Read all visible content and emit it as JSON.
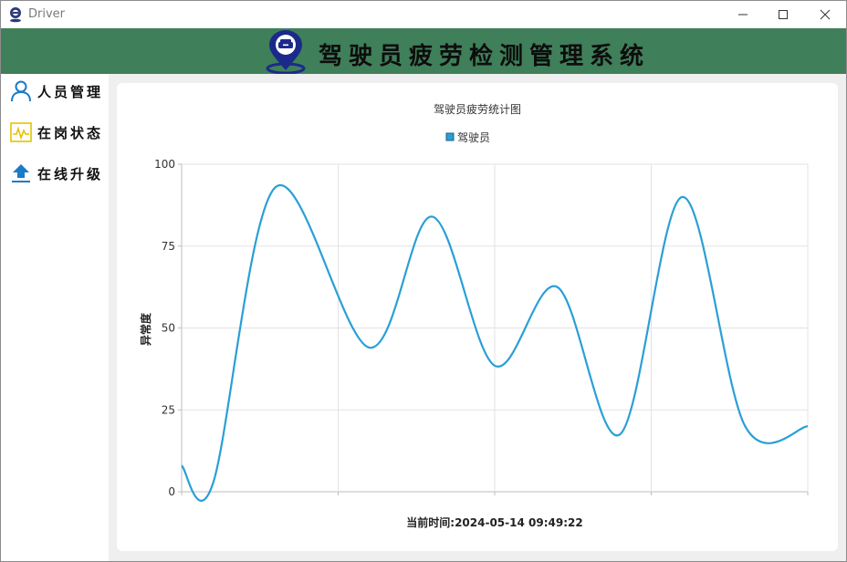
{
  "window": {
    "title": "Driver"
  },
  "banner": {
    "system_title": "驾驶员疲劳检测管理系统"
  },
  "sidebar": {
    "items": [
      {
        "label": "人员管理",
        "icon": "person-icon"
      },
      {
        "label": "在岗状态",
        "icon": "pulse-icon"
      },
      {
        "label": "在线升级",
        "icon": "upload-icon"
      }
    ]
  },
  "colors": {
    "banner": "#3f7f5a",
    "series": "#2a9fd6",
    "upload_icon": "#1a7bc6",
    "pulse_icon": "#e6c200",
    "person_icon": "#1a7bc6"
  },
  "chart_data": {
    "type": "line",
    "title": "驾驶员疲劳统计图",
    "ylabel": "异常度",
    "xlabel": "当前时间:2024-05-14 09:49:22",
    "ylim": [
      0,
      100
    ],
    "yticks": [
      "0",
      "25",
      "50",
      "75",
      "100"
    ],
    "grid": true,
    "legend_position": "top-center",
    "series": [
      {
        "name": "驾驶员",
        "x": [
          0,
          0.2,
          0.6,
          1.2,
          1.6,
          2.0,
          2.4,
          2.8,
          3.2,
          3.6,
          4.0
        ],
        "values": [
          8,
          2.5,
          93,
          44,
          84,
          38.5,
          62.5,
          17.5,
          90,
          20,
          20
        ]
      }
    ],
    "xlim": [
      0,
      4
    ]
  }
}
